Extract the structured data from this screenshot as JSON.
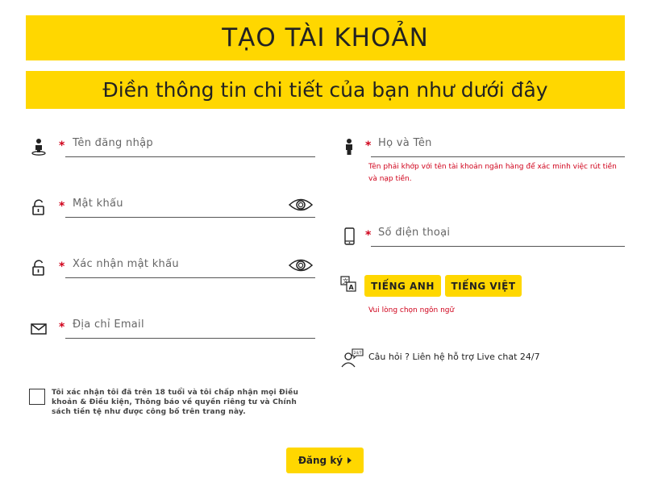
{
  "header": {
    "title": "TẠO TÀI KHOẢN",
    "subtitle": "Điền thông tin chi tiết của bạn như dưới đây"
  },
  "form": {
    "required_mark": "*",
    "username": {
      "placeholder": "Tên đăng nhập",
      "icon": "user-pin-icon"
    },
    "password": {
      "placeholder": "Mật khẩu",
      "icon": "lock-icon"
    },
    "confirm_password": {
      "placeholder": "Xác nhận mật khẩu",
      "icon": "lock-icon"
    },
    "email": {
      "placeholder": "Địa chỉ Email",
      "icon": "mail-icon"
    },
    "fullname": {
      "placeholder": "Họ và Tên",
      "icon": "person-icon"
    },
    "fullname_note": "Tên phải khớp với tên tài khoản ngân hàng để xác minh việc rút tiền và nạp tiền.",
    "phone": {
      "placeholder": "Số điện thoại",
      "icon": "phone-icon"
    }
  },
  "language": {
    "options": [
      "TIẾNG ANH",
      "TIẾNG VIỆT"
    ],
    "error": "Vui lòng chọn ngôn ngữ"
  },
  "help": {
    "text": "Câu hỏi ? Liên hệ hỗ trợ Live chat 24/7"
  },
  "terms": {
    "text": "Tôi xác nhận tôi đã trên 18 tuổi và tôi chấp nhận mọi Điều khoản & Điều kiện, Thông báo về quyền riêng tư và Chính sách tiền tệ như được công bố trên trang này."
  },
  "submit": {
    "label": "Đăng ký"
  },
  "colors": {
    "accent": "#ffd700",
    "error": "#d0021b"
  }
}
